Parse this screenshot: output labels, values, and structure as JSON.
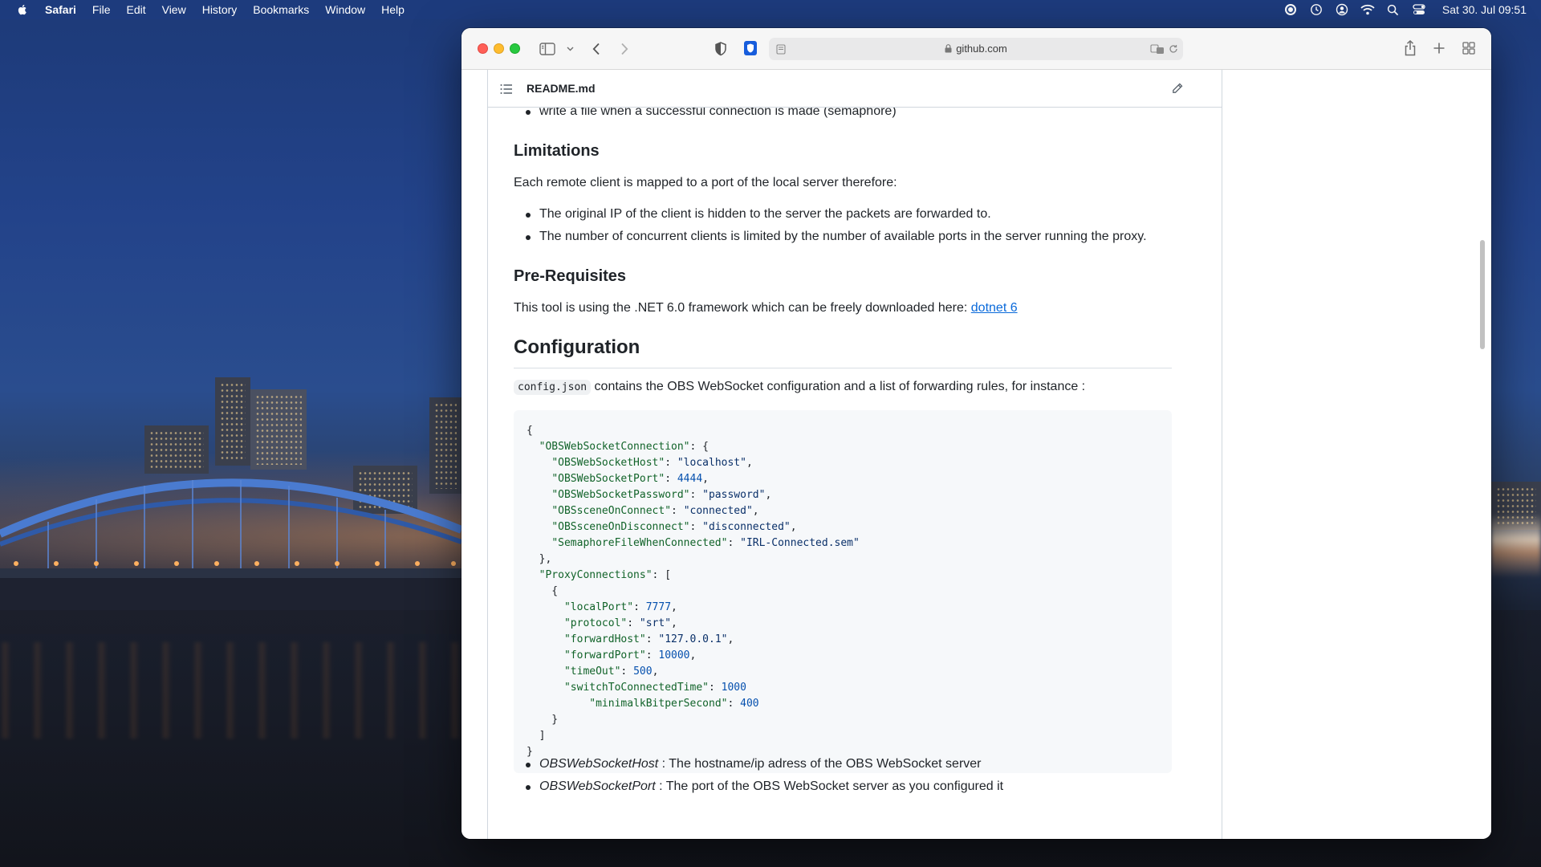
{
  "menubar": {
    "app": "Safari",
    "items": [
      "File",
      "Edit",
      "View",
      "History",
      "Bookmarks",
      "Window",
      "Help"
    ],
    "clock": "Sat 30. Jul  09:51"
  },
  "browser": {
    "url": "github.com"
  },
  "readme": {
    "filename": "README.md",
    "partial_bullet": "write a file when a successful connection is made (semaphore)",
    "limitations_heading": "Limitations",
    "limitations_intro": "Each remote client is mapped to a port of the local server therefore:",
    "limitations_items": [
      "The original IP of the client is hidden to the server the packets are forwarded to.",
      "The number of concurrent clients is limited by the number of available ports in the server running the proxy."
    ],
    "prereq_heading": "Pre-Requisites",
    "prereq_text": "This tool is using the .NET 6.0 framework which can be freely downloaded here: ",
    "prereq_link": "dotnet 6",
    "config_heading": "Configuration",
    "config_code_name": "config.json",
    "config_intro": " contains the OBS WebSocket configuration and a list of forwarding rules, for instance :",
    "code_lines": [
      "{",
      "  \"OBSWebSocketConnection\": {",
      "    \"OBSWebSocketHost\": \"localhost\",",
      "    \"OBSWebSocketPort\": 4444,",
      "    \"OBSWebSocketPassword\": \"password\",",
      "    \"OBSsceneOnConnect\": \"connected\",",
      "    \"OBSsceneOnDisconnect\": \"disconnected\",",
      "    \"SemaphoreFileWhenConnected\": \"IRL-Connected.sem\"",
      "  },",
      "  \"ProxyConnections\": [",
      "    {",
      "      \"localPort\": 7777,",
      "      \"protocol\": \"srt\",",
      "      \"forwardHost\": \"127.0.0.1\",",
      "      \"forwardPort\": 10000,",
      "      \"timeOut\": 500,",
      "      \"switchToConnectedTime\": 1000",
      "          \"minimalkBitperSecond\": 400",
      "    }",
      "  ]",
      "}"
    ],
    "defs": [
      {
        "term": "OBSWebSocketHost",
        "desc": " : The hostname/ip adress of the OBS WebSocket server"
      },
      {
        "term": "OBSWebSocketPort",
        "desc": " : The port of the OBS WebSocket server as you configured it"
      }
    ]
  }
}
